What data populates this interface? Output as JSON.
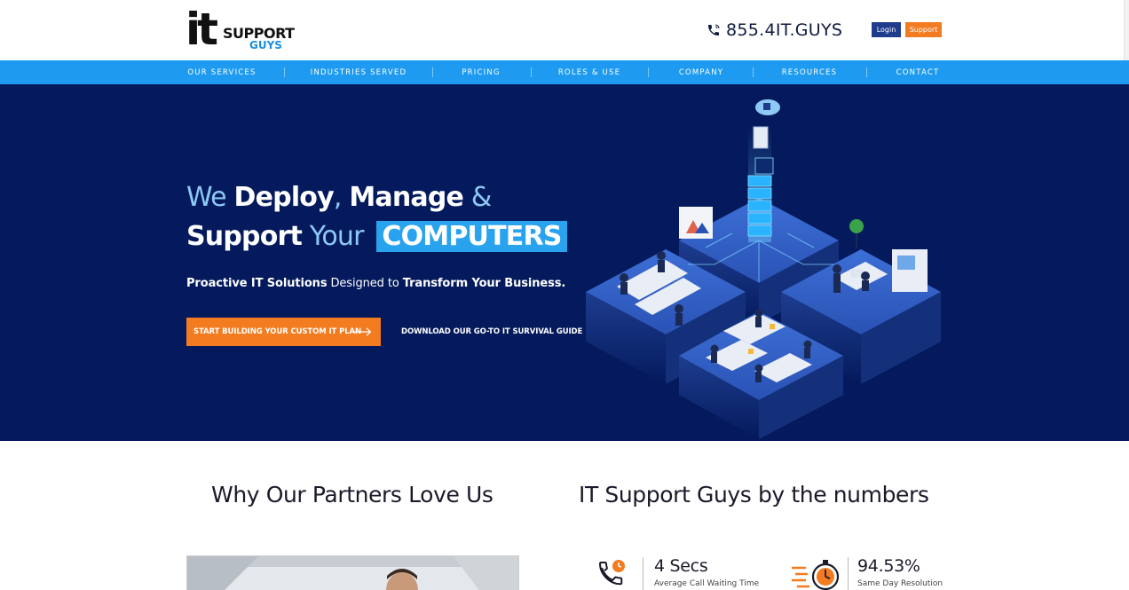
{
  "header": {
    "logo": {
      "it": "it",
      "support": "SUPPORT",
      "guys": "GUYS"
    },
    "phone": "855.4IT.GUYS",
    "login_label": "Login",
    "support_label": "Support"
  },
  "nav": {
    "items": [
      {
        "label": "OUR SERVICES"
      },
      {
        "label": "INDUSTRIES SERVED"
      },
      {
        "label": "PRICING"
      },
      {
        "label": "ROLES & USE"
      },
      {
        "label": "COMPANY"
      },
      {
        "label": "RESOURCES"
      },
      {
        "label": "CONTACT"
      }
    ]
  },
  "hero": {
    "line1": {
      "we": "We ",
      "deploy": "Deploy",
      "comma": ", ",
      "manage": "Manage",
      "amp": " &"
    },
    "line2": {
      "support": "Support",
      "your": " Your ",
      "computers": "COMPUTERS"
    },
    "sub": {
      "p1": "Proactive IT Solutions",
      "p2": " Designed to ",
      "p3": "Transform Your Business."
    },
    "cta_primary": "START BUILDING YOUR CUSTOM IT PLAN",
    "cta_secondary": "DOWNLOAD OUR GO-TO IT SURVIVAL GUIDE"
  },
  "sections": {
    "partners_title": "Why Our Partners Love Us",
    "numbers_title": "IT Support Guys by the numbers"
  },
  "stats": [
    {
      "value": "4 Secs",
      "label": "Average Call Waiting Time",
      "icon": "phone-clock-icon"
    },
    {
      "value": "94.53%",
      "label": "Same Day Resolution",
      "icon": "stopwatch-icon"
    }
  ],
  "colors": {
    "brand_blue": "#1e9bf0",
    "hero_bg": "#041a5c",
    "accent_orange": "#f37b20",
    "login_blue": "#1e3b8c",
    "highlight": "#2aa3ee"
  }
}
